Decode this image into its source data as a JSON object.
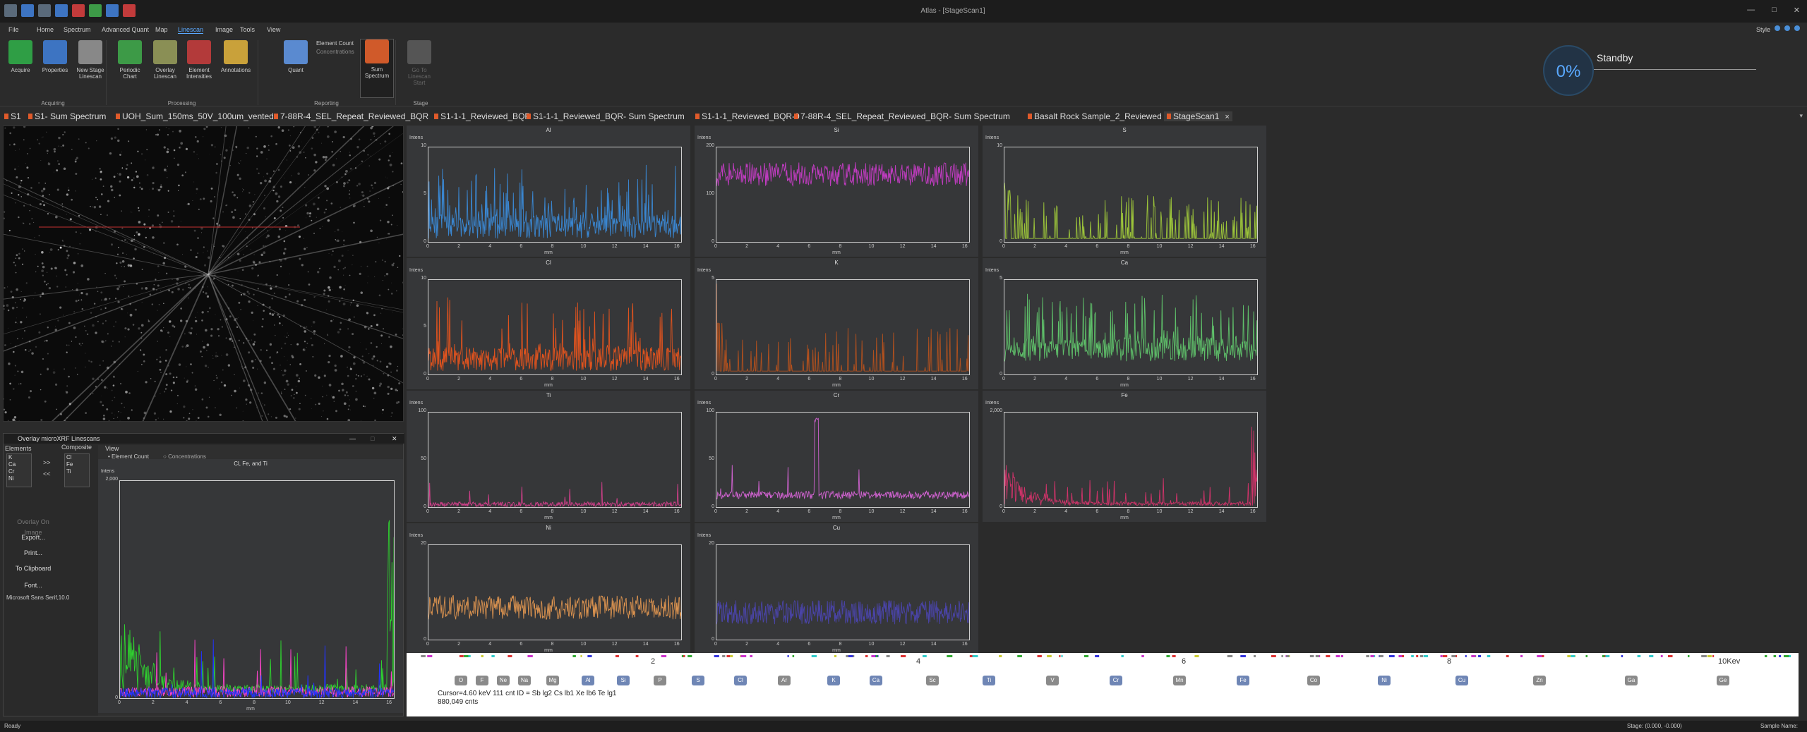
{
  "window": {
    "title": "Atlas - [StageScan1]"
  },
  "menu": [
    "File",
    "Home",
    "Spectrum",
    "Advanced Quant",
    "Map",
    "Linescan",
    "Image",
    "Tools",
    "View"
  ],
  "menu_active": "Linescan",
  "style_menu": "Style",
  "ribbon": {
    "buttons": [
      {
        "label": "Acquire",
        "color": "#2f9e45"
      },
      {
        "label": "Properties",
        "color": "#3d74c2"
      },
      {
        "label": "New Stage Linescan",
        "color": "#888888"
      },
      {
        "label": "Periodic Chart",
        "color": "#3d9a47"
      },
      {
        "label": "Overlay Linescan",
        "color": "#8a8f55"
      },
      {
        "label": "Element Intensities",
        "color": "#b33a3a"
      },
      {
        "label": "Annotations",
        "color": "#c9a13a"
      },
      {
        "label": "Quant",
        "color": "#5a8ad0"
      },
      {
        "label": "Sum Spectrum",
        "color": "#d05a2a"
      },
      {
        "label": "Go To Linescan Start",
        "color": "#555555"
      }
    ],
    "options": {
      "element_count": "Element Count",
      "concentrations": "Concentrations"
    },
    "groups": [
      "Acquiring",
      "Processing",
      "Reporting",
      "Stage"
    ]
  },
  "status": {
    "progress": "0%",
    "label": "Standby"
  },
  "doc_tabs": [
    "S1",
    "S1- Sum Spectrum",
    "UOH_Sum_150ms_50V_100um_vented",
    "7-88R-4_SEL_Repeat_Reviewed_BQR",
    "S1-1-1_Reviewed_BQR",
    "S1-1-1_Reviewed_BQR- Sum Spectrum",
    "S1-1-1_Reviewed_BQR-0",
    "7-88R-4_SEL_Repeat_Reviewed_BQR- Sum Spectrum",
    "Basalt Rock Sample_2_Reviewed",
    "StageScan1"
  ],
  "doc_tab_close": "×",
  "overlay_window": {
    "title": "Overlay microXRF Linescans",
    "controls": {
      "min": "—",
      "max": "□",
      "close": "✕"
    },
    "elements_label": "Elements",
    "composite_label": "Composite",
    "view_label": "View",
    "elements": [
      "K",
      "Ca",
      "Cr",
      "Ni"
    ],
    "composite": [
      "Cl",
      "Fe",
      "Ti"
    ],
    "move_right": ">>",
    "move_left": "<<",
    "view_options": {
      "element_count": "Element Count",
      "concentrations": "Concentrations"
    },
    "buttons": [
      "Overlay On Image",
      "Export...",
      "Print...",
      "To Clipboard",
      "Font..."
    ],
    "font_label": "Microsoft Sans Serif,10.0"
  },
  "overlay_chart": {
    "title": "Cl, Fe, and Ti",
    "ylabel": "Intens",
    "xlabel": "mm",
    "yticks": [
      "2,000",
      "0"
    ],
    "xticks": [
      "0",
      "2",
      "4",
      "6",
      "8",
      "10",
      "12",
      "14",
      "16"
    ],
    "series": [
      {
        "color": "#2fd12f"
      },
      {
        "color": "#ff44cc"
      },
      {
        "color": "#2233ff"
      }
    ]
  },
  "chart_data": [
    {
      "type": "line",
      "title": "Al",
      "xlabel": "mm",
      "ylabel": "Intens",
      "yticks": [
        "10",
        "5",
        "0"
      ],
      "xticks": [
        "0",
        "2",
        "4",
        "6",
        "8",
        "10",
        "12",
        "14",
        "16"
      ],
      "ylim": [
        0,
        10
      ],
      "color": "#3a86d0",
      "baseline": 0.05,
      "mode": "spiky"
    },
    {
      "type": "line",
      "title": "Si",
      "xlabel": "mm",
      "ylabel": "Intens",
      "yticks": [
        "200",
        "100",
        "0"
      ],
      "xticks": [
        "0",
        "2",
        "4",
        "6",
        "8",
        "10",
        "12",
        "14",
        "16"
      ],
      "ylim": [
        0,
        260
      ],
      "color": "#c03cc0",
      "baseline": 0.72,
      "mode": "noisy"
    },
    {
      "type": "line",
      "title": "S",
      "xlabel": "mm",
      "ylabel": "Intens",
      "yticks": [
        "10",
        "0"
      ],
      "xticks": [
        "0",
        "2",
        "4",
        "6",
        "8",
        "10",
        "12",
        "14",
        "16"
      ],
      "ylim": [
        0,
        12
      ],
      "color": "#9cc43a",
      "baseline": 0.05,
      "mode": "sparse"
    },
    {
      "type": "line",
      "title": "Cl",
      "xlabel": "mm",
      "ylabel": "Intens",
      "yticks": [
        "10",
        "5",
        "0"
      ],
      "xticks": [
        "0",
        "2",
        "4",
        "6",
        "8",
        "10",
        "12",
        "14",
        "16"
      ],
      "ylim": [
        0,
        10
      ],
      "color": "#e0531e",
      "baseline": 0.05,
      "mode": "spiky"
    },
    {
      "type": "line",
      "title": "K",
      "xlabel": "mm",
      "ylabel": "Intens",
      "yticks": [
        "5",
        "0"
      ],
      "xticks": [
        "0",
        "2",
        "4",
        "6",
        "8",
        "10",
        "12",
        "14",
        "16"
      ],
      "ylim": [
        0,
        6
      ],
      "color": "#b0501e",
      "baseline": 0.05,
      "mode": "sparse"
    },
    {
      "type": "line",
      "title": "Ca",
      "xlabel": "mm",
      "ylabel": "Intens",
      "yticks": [
        "5",
        "0"
      ],
      "xticks": [
        "0",
        "2",
        "4",
        "6",
        "8",
        "10",
        "12",
        "14",
        "16"
      ],
      "ylim": [
        0,
        8
      ],
      "color": "#5fc06a",
      "baseline": 0.15,
      "mode": "spiky"
    },
    {
      "type": "line",
      "title": "Ti",
      "xlabel": "mm",
      "ylabel": "Intens",
      "yticks": [
        "100",
        "50",
        "0"
      ],
      "xticks": [
        "0",
        "2",
        "4",
        "6",
        "8",
        "10",
        "12",
        "14",
        "16"
      ],
      "ylim": [
        0,
        130
      ],
      "color": "#d03f8a",
      "baseline": 0.02,
      "mode": "quiet"
    },
    {
      "type": "line",
      "title": "Cr",
      "xlabel": "mm",
      "ylabel": "Intens",
      "yticks": [
        "100",
        "50",
        "0"
      ],
      "xticks": [
        "0",
        "2",
        "4",
        "6",
        "8",
        "10",
        "12",
        "14",
        "16"
      ],
      "ylim": [
        0,
        130
      ],
      "color": "#cf62cf",
      "baseline": 0.1,
      "mode": "peak",
      "peak_at": 6.5
    },
    {
      "type": "line",
      "title": "Fe",
      "xlabel": "mm",
      "ylabel": "Intens",
      "yticks": [
        "2,000",
        "0"
      ],
      "xticks": [
        "0",
        "2",
        "4",
        "6",
        "8",
        "10",
        "12",
        "14",
        "16"
      ],
      "ylim": [
        0,
        2600
      ],
      "color": "#d0336a",
      "baseline": 0.03,
      "mode": "decay"
    },
    {
      "type": "line",
      "title": "Ni",
      "xlabel": "mm",
      "ylabel": "Intens",
      "yticks": [
        "20",
        "0"
      ],
      "xticks": [
        "0",
        "2",
        "4",
        "6",
        "8",
        "10",
        "12",
        "14",
        "16"
      ],
      "ylim": [
        0,
        30
      ],
      "color": "#d8914f",
      "baseline": 0.35,
      "mode": "noisy"
    },
    {
      "type": "line",
      "title": "Cu",
      "xlabel": "mm",
      "ylabel": "Intens",
      "yticks": [
        "20",
        "0"
      ],
      "xticks": [
        "0",
        "2",
        "4",
        "6",
        "8",
        "10",
        "12",
        "14",
        "16"
      ],
      "ylim": [
        0,
        30
      ],
      "color": "#4a44a8",
      "baseline": 0.3,
      "mode": "noisy"
    }
  ],
  "spectrum": {
    "xticks": [
      "2",
      "4",
      "6",
      "8",
      "10Kev"
    ],
    "elements": [
      "O",
      "F",
      "Ne",
      "Na",
      "Mg",
      "Al",
      "Si",
      "P",
      "S",
      "Cl",
      "Ar",
      "K",
      "Ca",
      "Sc",
      "Ti",
      "V",
      "Cr",
      "Mn",
      "Fe",
      "Co",
      "Ni",
      "Cu",
      "Zn",
      "Ga",
      "Ge"
    ],
    "highlight": [
      "Al",
      "Si",
      "S",
      "Cl",
      "K",
      "Ca",
      "Ti",
      "Cr",
      "Fe",
      "Ni",
      "Cu"
    ],
    "cursor": "Cursor=4.60 keV   111 cnt  ID = Sb lg2  Cs lb1  Xe lb6  Te lg1",
    "counts": "880,049 cnts"
  },
  "statusbar": {
    "left": "Ready",
    "stage": "Stage: (0.000, -0.000)",
    "sample": "Sample Name:"
  }
}
